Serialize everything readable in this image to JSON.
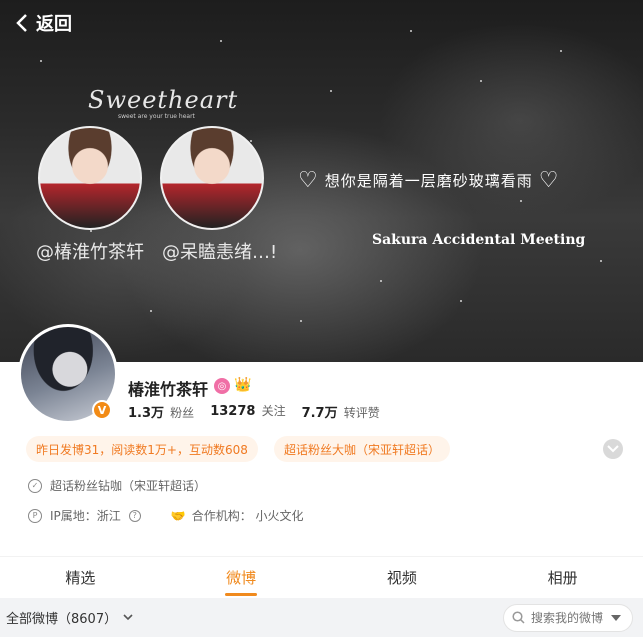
{
  "header": {
    "back_label": "返回"
  },
  "banner": {
    "sweet_title": "Sweetheart",
    "sweet_subtitle": "sweet are your true heart",
    "names": [
      "@椿淮竹茶轩",
      "@呆瞌恚绪…!"
    ],
    "quote": "想你是隔着一层磨砂玻璃看雨",
    "meeting": "Sakura Accidental Meeting"
  },
  "profile": {
    "username": "椿淮竹茶轩",
    "stats": [
      {
        "value": "1.3万",
        "label": "粉丝"
      },
      {
        "value": "13278",
        "label": "关注"
      },
      {
        "value": "7.7万",
        "label": "转评赞"
      }
    ],
    "chips": [
      "昨日发博31，阅读数1万+，互动数608",
      "超话粉丝大咖（宋亚轩超话）"
    ],
    "info": {
      "supertopic": "超话粉丝钻咖（宋亚轩超话）",
      "ip": "IP属地：浙江",
      "agency": "合作机构：  小火文化"
    }
  },
  "tabs": [
    "精选",
    "微博",
    "视频",
    "相册"
  ],
  "active_tab": "微博",
  "filter": {
    "label": "全部微博（8607）",
    "search_placeholder": "搜索我的微博"
  },
  "colors": {
    "accent": "#f08a1e",
    "chip_bg": "#fff4ea",
    "verified": "#f28b16"
  }
}
